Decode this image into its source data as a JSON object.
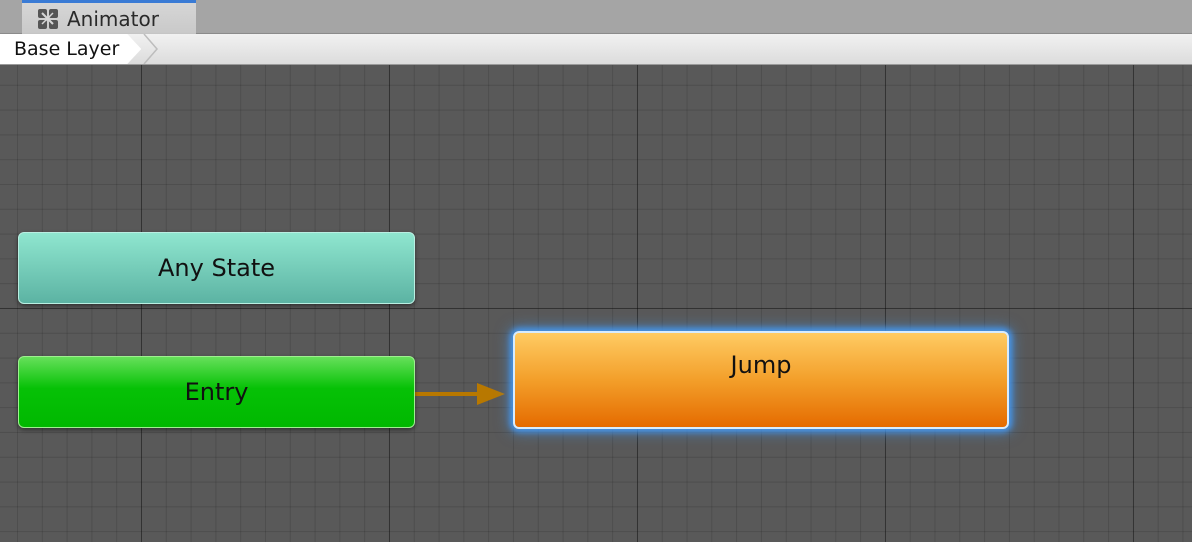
{
  "window": {
    "tab_label": "Animator",
    "tab_icon": "animator-icon",
    "tab_accent_color": "#3a7bd5"
  },
  "breadcrumb": {
    "items": [
      "Base Layer"
    ]
  },
  "graph": {
    "states": {
      "any_state": {
        "label": "Any State",
        "color": "#73ccb9"
      },
      "entry": {
        "label": "Entry",
        "color": "#00b800"
      },
      "jump": {
        "label": "Jump",
        "color": "#f39f2a",
        "selected": true,
        "is_default": true
      }
    },
    "transitions": [
      {
        "from": "Entry",
        "to": "Jump",
        "color": "#b87800"
      }
    ]
  }
}
